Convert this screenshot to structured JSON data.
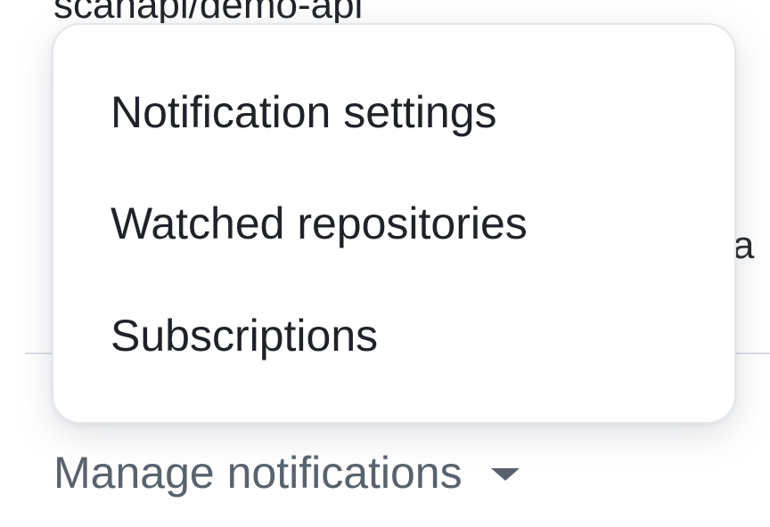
{
  "background": {
    "repo_link": "scanapi/demo-api",
    "right_text": "va"
  },
  "menu": {
    "items": [
      {
        "label": "Notification settings"
      },
      {
        "label": "Watched repositories"
      },
      {
        "label": "Subscriptions"
      }
    ]
  },
  "trigger": {
    "label": "Manage notifications",
    "icon": "triangle-down-icon"
  },
  "colors": {
    "text": "#1f2328",
    "muted": "#59636e",
    "border": "#e4e7eb",
    "divider": "#d8dee4"
  }
}
